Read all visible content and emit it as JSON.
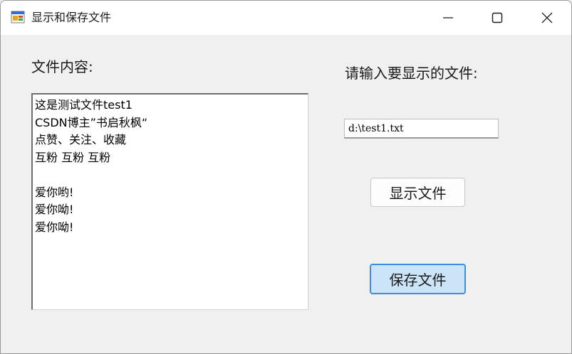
{
  "window": {
    "title": "显示和保存文件",
    "icons": {
      "app": "app-form-icon",
      "minimize": "minimize-icon",
      "maximize": "maximize-icon",
      "close": "close-icon"
    }
  },
  "labels": {
    "file_content": "文件内容:",
    "input_prompt": "请输入要显示的文件:"
  },
  "content_box": {
    "text": "这是测试文件test1\nCSDN博主”书启秋枫“\n点赞、关注、收藏\n互粉 互粉 互粉\n\n爱你哟!\n爱你呦!\n爱你呦!"
  },
  "path_field": {
    "value": "d:\\test1.txt"
  },
  "buttons": {
    "show": "显示文件",
    "save": "保存文件"
  },
  "colors": {
    "focused_button_bg": "#cce4f7",
    "focused_button_border": "#3b8ede",
    "client_bg": "#f0f0f0"
  }
}
